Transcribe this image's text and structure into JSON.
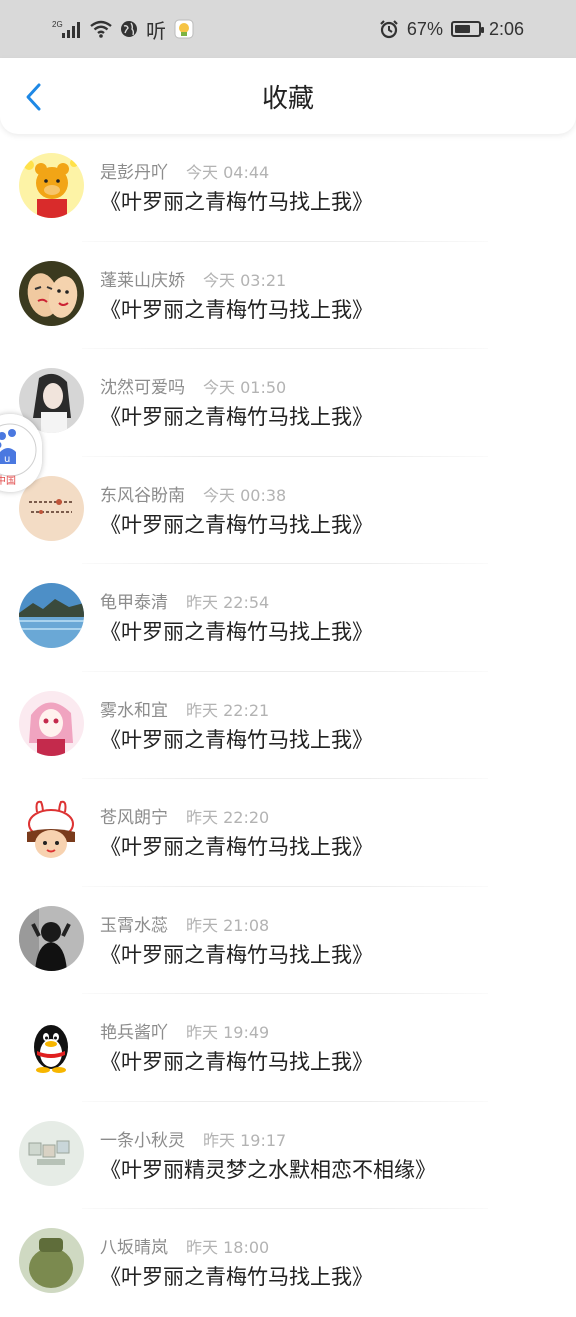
{
  "status_bar": {
    "signal_label": "2G",
    "listen_label": "听",
    "battery": "67%",
    "battery_level": 0.67,
    "time": "2:06"
  },
  "header": {
    "title": "收藏",
    "back_icon": "chevron-left-icon"
  },
  "colors": {
    "accent": "#1e88e5",
    "status_bar_bg": "#d9d9d9",
    "name_text": "#8c8c8c",
    "time_text": "#b3b3b3"
  },
  "favorites": [
    {
      "name": "是彭丹吖",
      "time": "今天 04:44",
      "content": "《叶罗丽之青梅竹马找上我》",
      "avatar": "winnie-pooh-avatar"
    },
    {
      "name": "蓬莱山庆娇",
      "time": "今天 03:21",
      "content": "《叶罗丽之青梅竹马找上我》",
      "avatar": "cartoon-faces-avatar"
    },
    {
      "name": "沈然可爱吗",
      "time": "今天 01:50",
      "content": "《叶罗丽之青梅竹马找上我》",
      "avatar": "girl-photo-avatar"
    },
    {
      "name": "东风谷盼南",
      "time": "今天 00:38",
      "content": "《叶罗丽之青梅竹马找上我》",
      "avatar": "text-card-avatar"
    },
    {
      "name": "龟甲泰清",
      "time": "昨天 22:54",
      "content": "《叶罗丽之青梅竹马找上我》",
      "avatar": "lake-landscape-avatar"
    },
    {
      "name": "雾水和宜",
      "time": "昨天 22:21",
      "content": "《叶罗丽之青梅竹马找上我》",
      "avatar": "anime-girl-avatar"
    },
    {
      "name": "苍风朗宁",
      "time": "昨天 22:20",
      "content": "《叶罗丽之青梅竹马找上我》",
      "avatar": "bunny-hat-girl-avatar"
    },
    {
      "name": "玉霄水蕊",
      "time": "昨天 21:08",
      "content": "《叶罗丽之青梅竹马找上我》",
      "avatar": "dark-figure-avatar"
    },
    {
      "name": "艳兵酱吖",
      "time": "昨天 19:49",
      "content": "《叶罗丽之青梅竹马找上我》",
      "avatar": "qq-penguin-avatar"
    },
    {
      "name": "一条小秋灵",
      "time": "昨天 19:17",
      "content": "《叶罗丽精灵梦之水默相恋不相缘》",
      "avatar": "blocks-avatar"
    },
    {
      "name": "八坂晴岚",
      "time": "昨天 18:00",
      "content": "《叶罗丽之青梅竹马找上我》",
      "avatar": "green-object-avatar"
    }
  ],
  "floating_assistant": {
    "icon": "baidu-paw-icon",
    "label": "中国"
  }
}
